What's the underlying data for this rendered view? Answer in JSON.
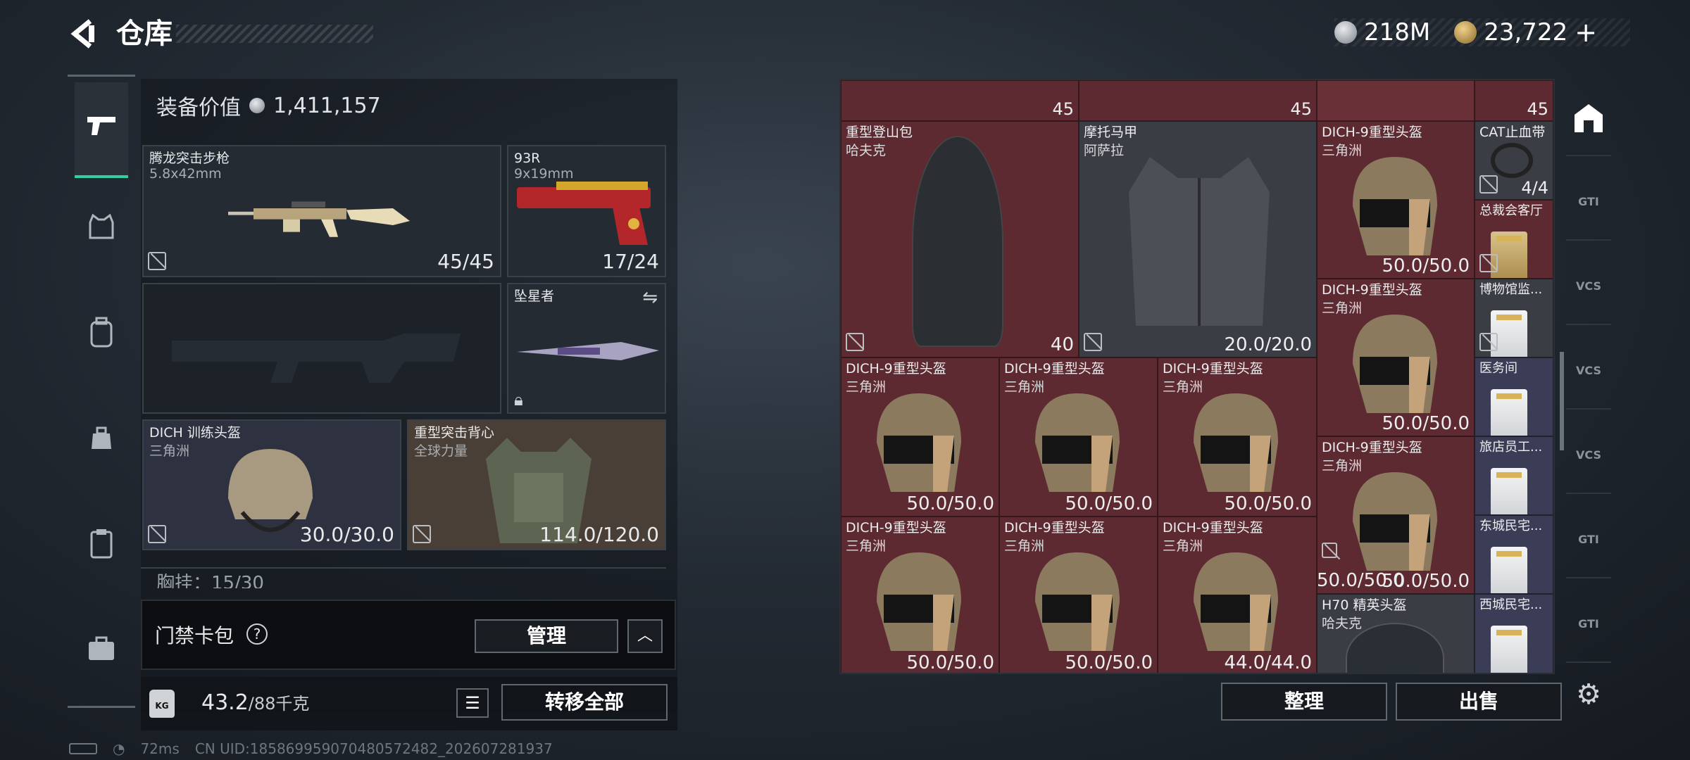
{
  "header": {
    "back_icon": "back-arrow-icon",
    "title": "仓库",
    "currency_silver": "218M",
    "currency_gold": "23,722",
    "add_label": "+"
  },
  "left_nav": [
    "gun-icon",
    "armor-icon",
    "backpack-icon",
    "pouch-icon",
    "clipboard-icon",
    "briefcase-icon"
  ],
  "equipment": {
    "value_label": "装备价值",
    "value": "1,411,157",
    "primary": {
      "name": "腾龙突击步枪",
      "caliber": "5.8x42mm",
      "ammo": "45/45"
    },
    "pistol": {
      "name": "93R",
      "caliber": "9x19mm",
      "ammo": "17/24"
    },
    "melee": {
      "name": "坠星者"
    },
    "helmet": {
      "name": "DICH 训练头盔",
      "faction": "三角洲",
      "durability": "30.0/30.0"
    },
    "armor": {
      "name": "重型突击背心",
      "faction": "全球力量",
      "durability": "114.0/120.0"
    },
    "chest_rig": "胸挂：15/30"
  },
  "card_pack": {
    "label": "门禁卡包",
    "help": "?",
    "manage": "管理"
  },
  "bottom": {
    "weight": "43.2",
    "weight_max": "/88千克",
    "transfer": "转移全部"
  },
  "grid": {
    "top_counts": [
      "45",
      "45",
      "45"
    ],
    "backpack": {
      "name": "重型登山包",
      "faction": "哈夫克",
      "count": "40"
    },
    "vest": {
      "name": "摩托马甲",
      "faction": "阿萨拉",
      "durability": "20.0/20.0"
    },
    "helm_name": "DICH-9重型头盔",
    "helm_faction": "三角洲",
    "helm_values": [
      "50.0/50.0",
      "50.0/50.0",
      "50.0/50.0",
      "50.0/50.0",
      "50.0/50.0",
      "50.0/50.0",
      "50.0/50.0",
      "50.0/50.0",
      "50.0/50.0",
      "44.0/44.0"
    ],
    "h70": {
      "name": "H70 精英头盔",
      "faction": "哈夫克"
    },
    "tourniquet": {
      "name": "CAT止血带",
      "count": "4/4"
    },
    "keys": [
      "总裁会客厅",
      "博物馆监...",
      "医务间",
      "旅店员工...",
      "东城民宅...",
      "西城民宅..."
    ],
    "sort": "整理",
    "sell": "出售"
  },
  "right_rail": [
    "shelter-icon",
    "gti-icon",
    "vcs-icon",
    "vcs-icon",
    "vcs-icon",
    "gti-icon",
    "gti-icon",
    "gear-icon"
  ],
  "status": {
    "ping": "72ms",
    "uid": "CN UID:18586995907048057248​2_202607281937"
  }
}
